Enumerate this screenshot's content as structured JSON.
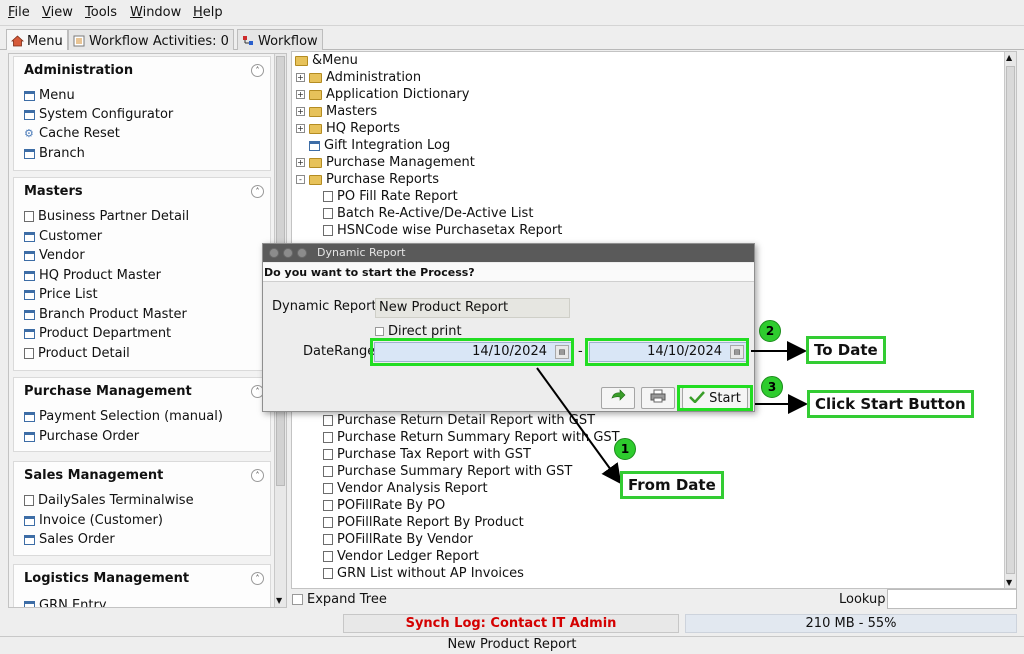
{
  "menubar": [
    "File",
    "View",
    "Tools",
    "Window",
    "Help"
  ],
  "tabs": {
    "menu": "Menu",
    "workflow_activities": "Workflow Activities: 0",
    "workflow": "Workflow"
  },
  "left_panel": {
    "groups": [
      {
        "title": "Administration",
        "items": [
          {
            "label": "Menu",
            "icon": "window-icon"
          },
          {
            "label": "System Configurator",
            "icon": "window-icon"
          },
          {
            "label": "Cache Reset",
            "icon": "gear-icon"
          },
          {
            "label": "Branch",
            "icon": "window-icon"
          }
        ]
      },
      {
        "title": "Masters",
        "items": [
          {
            "label": "Business Partner Detail",
            "icon": "document-icon"
          },
          {
            "label": "Customer",
            "icon": "window-icon"
          },
          {
            "label": "Vendor",
            "icon": "window-icon"
          },
          {
            "label": "HQ Product Master",
            "icon": "window-icon"
          },
          {
            "label": "Price List",
            "icon": "window-icon"
          },
          {
            "label": "Branch Product Master",
            "icon": "window-icon"
          },
          {
            "label": "Product Department",
            "icon": "window-icon"
          },
          {
            "label": "Product Detail",
            "icon": "document-icon"
          }
        ]
      },
      {
        "title": "Purchase Management",
        "items": [
          {
            "label": "Payment Selection (manual)",
            "icon": "window-icon"
          },
          {
            "label": "Purchase Order",
            "icon": "window-icon"
          }
        ]
      },
      {
        "title": "Sales Management",
        "items": [
          {
            "label": "DailySales Terminalwise",
            "icon": "document-icon"
          },
          {
            "label": "Invoice (Customer)",
            "icon": "window-icon"
          },
          {
            "label": "Sales Order",
            "icon": "window-icon"
          }
        ]
      },
      {
        "title": "Logistics Management",
        "items": [
          {
            "label": "GRN Entry",
            "icon": "window-icon"
          }
        ]
      }
    ]
  },
  "tree": {
    "root": "&Menu",
    "nodes": [
      {
        "label": "Administration",
        "type": "folder"
      },
      {
        "label": "Application Dictionary",
        "type": "folder"
      },
      {
        "label": "Masters",
        "type": "folder"
      },
      {
        "label": "HQ Reports",
        "type": "folder"
      },
      {
        "label": "Gift Integration Log",
        "type": "window"
      },
      {
        "label": "Purchase Management",
        "type": "folder"
      },
      {
        "label": "Purchase Reports",
        "type": "open-folder"
      },
      {
        "label": "PO Fill Rate Report",
        "type": "report"
      },
      {
        "label": "Batch Re-Active/De-Active List",
        "type": "report"
      },
      {
        "label": "HSNCode wise Purchasetax Report",
        "type": "report"
      },
      {
        "label": "Purchase Return Detail Report with GST",
        "type": "report"
      },
      {
        "label": "Purchase Return Summary Report with GST",
        "type": "report"
      },
      {
        "label": "Purchase Tax Report with GST",
        "type": "report"
      },
      {
        "label": "Purchase Summary Report with GST",
        "type": "report"
      },
      {
        "label": "Vendor Analysis Report",
        "type": "report"
      },
      {
        "label": "POFillRate By PO",
        "type": "report"
      },
      {
        "label": "POFillRate Report By Product",
        "type": "report"
      },
      {
        "label": "POFillRate By Vendor",
        "type": "report"
      },
      {
        "label": "Vendor Ledger Report",
        "type": "report"
      },
      {
        "label": "GRN List without AP Invoices",
        "type": "report"
      }
    ]
  },
  "bottom": {
    "expand_tree": "Expand Tree",
    "lookup": "Lookup",
    "synch_log": "Synch Log: Contact IT Admin",
    "memory": "210 MB - 55%",
    "status": "New Product Report"
  },
  "dialog": {
    "title": "Dynamic Report",
    "question": "Do you want to start the Process?",
    "report_label": "Dynamic Report",
    "report_value": "New Product Report",
    "direct_print": "Direct print",
    "daterange_label": "DateRange",
    "from_date": "14/10/2024",
    "separator": "-",
    "to_date": "14/10/2024",
    "start_label": "Start"
  },
  "annotations": {
    "from_date": {
      "number": "1",
      "label": "From Date"
    },
    "to_date": {
      "number": "2",
      "label": "To Date"
    },
    "start": {
      "number": "3",
      "label": "Click Start Button"
    }
  },
  "colors": {
    "callout_green": "#22dd22",
    "synch_text": "#d40000",
    "date_field_bg": "#d9e6f6",
    "dialog_title_bg": "#5a5a5a"
  }
}
